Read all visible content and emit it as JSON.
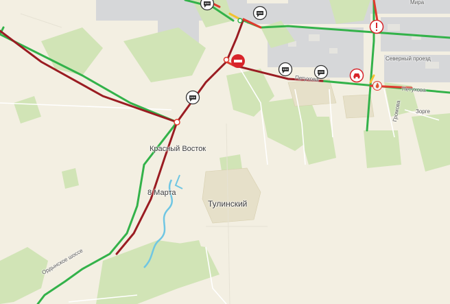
{
  "map": {
    "places": {
      "krasny_vostok": "Красный Восток",
      "vosmoe_marta": "8 Марта",
      "tulinsky": "Тулинский"
    },
    "streets": {
      "severny_proezd": "Северный проезд",
      "petukhova_left": "Петухова",
      "petukhova_right": "Петухова",
      "gromova": "Громова",
      "zorge": "Зорге",
      "mira": "Мира",
      "ordynskoe": "Ордынское шоссе"
    },
    "events": [
      {
        "type": "chat",
        "icon": "chat-bubble-icon"
      },
      {
        "type": "chat",
        "icon": "chat-bubble-icon"
      },
      {
        "type": "chat",
        "icon": "chat-bubble-icon"
      },
      {
        "type": "chat",
        "icon": "chat-bubble-icon"
      },
      {
        "type": "chat",
        "icon": "chat-bubble-icon"
      },
      {
        "type": "chat",
        "icon": "chat-bubble-icon"
      },
      {
        "type": "road-closed",
        "icon": "road-closed-icon"
      },
      {
        "type": "warning",
        "icon": "warning-icon"
      },
      {
        "type": "accident",
        "icon": "accident-icon"
      },
      {
        "type": "fire",
        "icon": "fire-icon"
      }
    ],
    "colors": {
      "background": "#f3efe2",
      "forest": "#cfe3b1",
      "urban": "#d9dadb",
      "traffic_free": "#33b24a",
      "traffic_jam": "#e03a2e",
      "traffic_heavy": "#9a1c22",
      "water": "#6fc6e3",
      "event_red": "#d8242a"
    }
  }
}
